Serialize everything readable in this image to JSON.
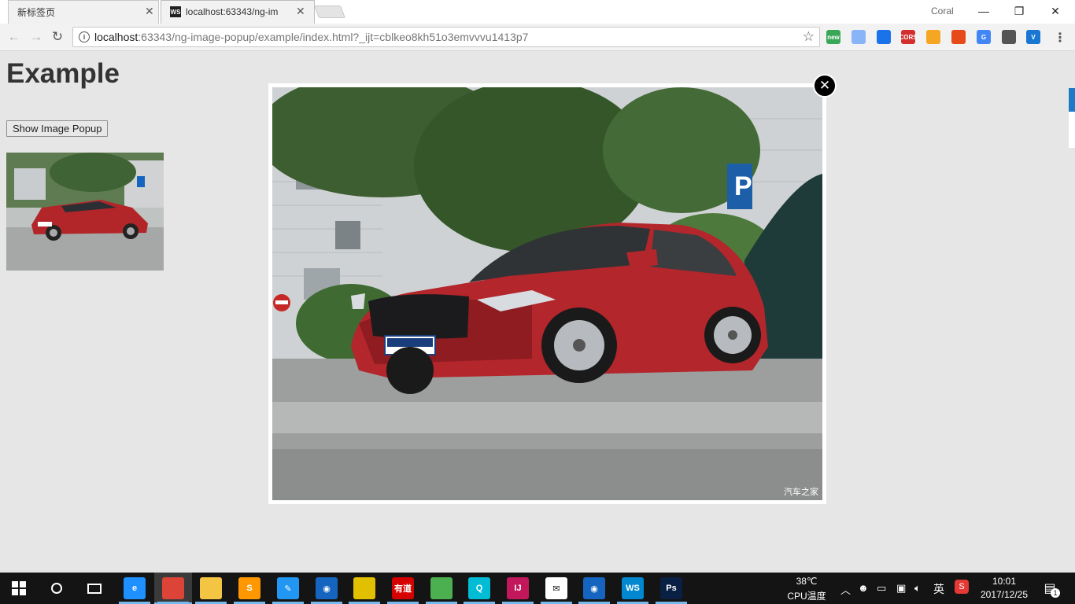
{
  "browser": {
    "tabs": [
      {
        "title": "新标签页",
        "active": false
      },
      {
        "title": "localhost:63343/ng-im",
        "active": true,
        "favicon": "WS"
      }
    ],
    "profile_name": "Coral",
    "url_host": "localhost",
    "url_rest": ":63343/ng-image-popup/example/index.html?_ijt=cblkeo8kh51o3emvvvu1413p7",
    "extensions": [
      {
        "name": "new-ext-icon",
        "label": "new",
        "color": "#3aa757"
      },
      {
        "name": "circle-ext-icon",
        "label": "",
        "color": "#8ab4f8"
      },
      {
        "name": "dropper-ext-icon",
        "label": "",
        "color": "#1a73e8"
      },
      {
        "name": "cors-ext-icon",
        "label": "CORS",
        "color": "#d32f2f"
      },
      {
        "name": "orange-ext-icon",
        "label": "",
        "color": "#f5a623"
      },
      {
        "name": "office-ext-icon",
        "label": "",
        "color": "#e64a19"
      },
      {
        "name": "translate-ext-icon",
        "label": "G",
        "color": "#4285f4"
      },
      {
        "name": "qr-ext-icon",
        "label": "",
        "color": "#555555"
      },
      {
        "name": "v-ext-icon",
        "label": "V",
        "color": "#1976d2"
      }
    ]
  },
  "page": {
    "title": "Example",
    "show_button_label": "Show Image Popup",
    "watermark": "汽车之家"
  },
  "taskbar": {
    "apps": [
      {
        "name": "edge-icon",
        "label": "e",
        "color": "#1e90ff"
      },
      {
        "name": "chrome-icon",
        "label": "",
        "color": "#db4437"
      },
      {
        "name": "explorer-icon",
        "label": "",
        "color": "#f4c542"
      },
      {
        "name": "sublime-icon",
        "label": "S",
        "color": "#ff9800"
      },
      {
        "name": "notes-icon",
        "label": "✎",
        "color": "#2196f3"
      },
      {
        "name": "maps-icon",
        "label": "◉",
        "color": "#1565c0"
      },
      {
        "name": "ruler-icon",
        "label": "",
        "color": "#e0c000"
      },
      {
        "name": "youdao-icon",
        "label": "有道",
        "color": "#d50000"
      },
      {
        "name": "wechat-icon",
        "label": "",
        "color": "#4caf50"
      },
      {
        "name": "search-q-icon",
        "label": "Q",
        "color": "#00bcd4"
      },
      {
        "name": "intellij-icon",
        "label": "IJ",
        "color": "#c2185b"
      },
      {
        "name": "mail-icon",
        "label": "✉",
        "color": "#ffffff"
      },
      {
        "name": "maps2-icon",
        "label": "◉",
        "color": "#1565c0"
      },
      {
        "name": "webstorm-icon",
        "label": "WS",
        "color": "#0288d1"
      },
      {
        "name": "photoshop-icon",
        "label": "Ps",
        "color": "#0a1f44"
      }
    ],
    "cpu_temp": "38℃",
    "cpu_label": "CPU温度",
    "ime": "英",
    "time": "10:01",
    "date": "2017/12/25",
    "notification_count": "1"
  }
}
